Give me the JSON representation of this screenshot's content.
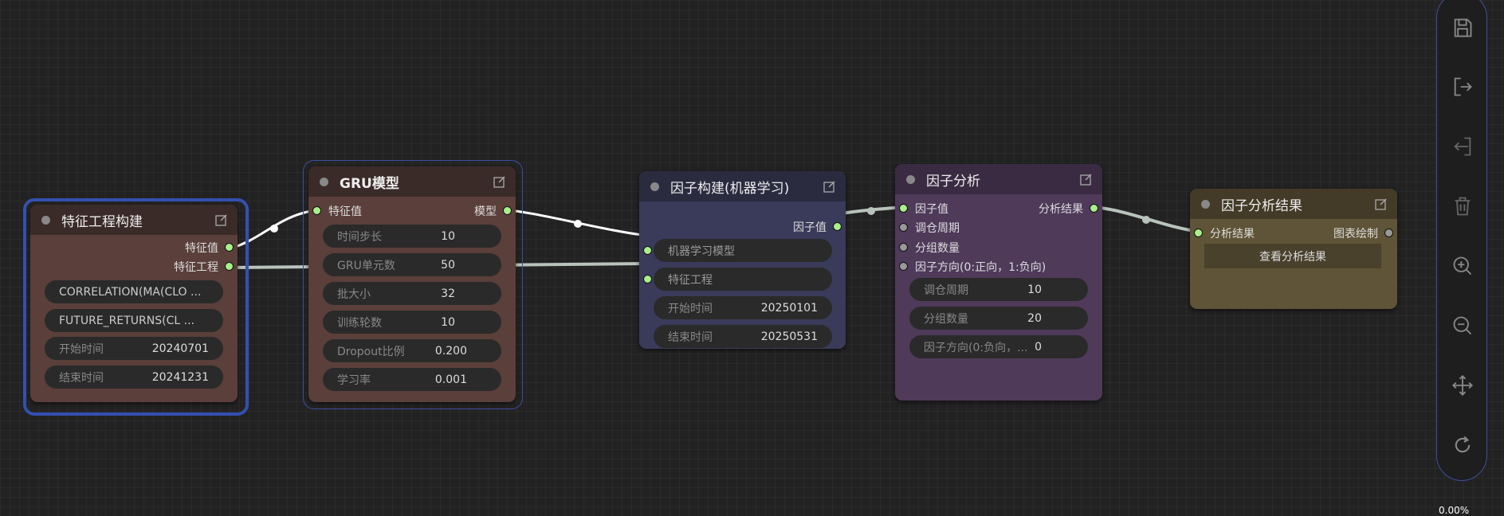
{
  "nodes": {
    "feature_eng": {
      "title": "特征工程构建",
      "out1": "特征值",
      "out2": "特征工程",
      "w1": "CORRELATION(MA(CLO ...",
      "w2": "FUTURE_RETURNS(CL ...",
      "w3_label": "开始时间",
      "w3_value": "20240701",
      "w4_label": "结束时间",
      "w4_value": "20241231"
    },
    "gru": {
      "title": "GRU模型",
      "in1": "特征值",
      "out1": "模型",
      "params": [
        {
          "label": "时间步长",
          "value": "10"
        },
        {
          "label": "GRU单元数",
          "value": "50"
        },
        {
          "label": "批大小",
          "value": "32"
        },
        {
          "label": "训练轮数",
          "value": "10"
        },
        {
          "label": "Dropout比例",
          "value": "0.200"
        },
        {
          "label": "学习率",
          "value": "0.001"
        }
      ]
    },
    "factor_ml": {
      "title": "因子构建(机器学习)",
      "out1": "因子值",
      "in1": "机器学习模型",
      "in2": "特征工程",
      "w1_label": "开始时间",
      "w1_value": "20250101",
      "w2_label": "结束时间",
      "w2_value": "20250531"
    },
    "factor_analysis": {
      "title": "因子分析",
      "in1": "因子值",
      "out1": "分析结果",
      "in2": "调仓周期",
      "in3": "分组数量",
      "in4": "因子方向(0:正向，1:负向)",
      "params": [
        {
          "label": "调仓周期",
          "value": "10"
        },
        {
          "label": "分组数量",
          "value": "20"
        },
        {
          "label": "因子方向(0:负向，...",
          "value": "0"
        }
      ]
    },
    "analysis_result": {
      "title": "因子分析结果",
      "in1": "分析结果",
      "out1": "图表绘制",
      "button": "查看分析结果"
    }
  },
  "toolbar": {
    "icons": [
      "save-icon",
      "export-icon",
      "import-icon",
      "trash-icon",
      "zoom-in-icon",
      "zoom-out-icon",
      "fit-view-icon",
      "refresh-icon"
    ],
    "zoom": "0.00%"
  },
  "colors": {
    "accent": "#3b4fa0",
    "port_green": "#a8f08a"
  }
}
